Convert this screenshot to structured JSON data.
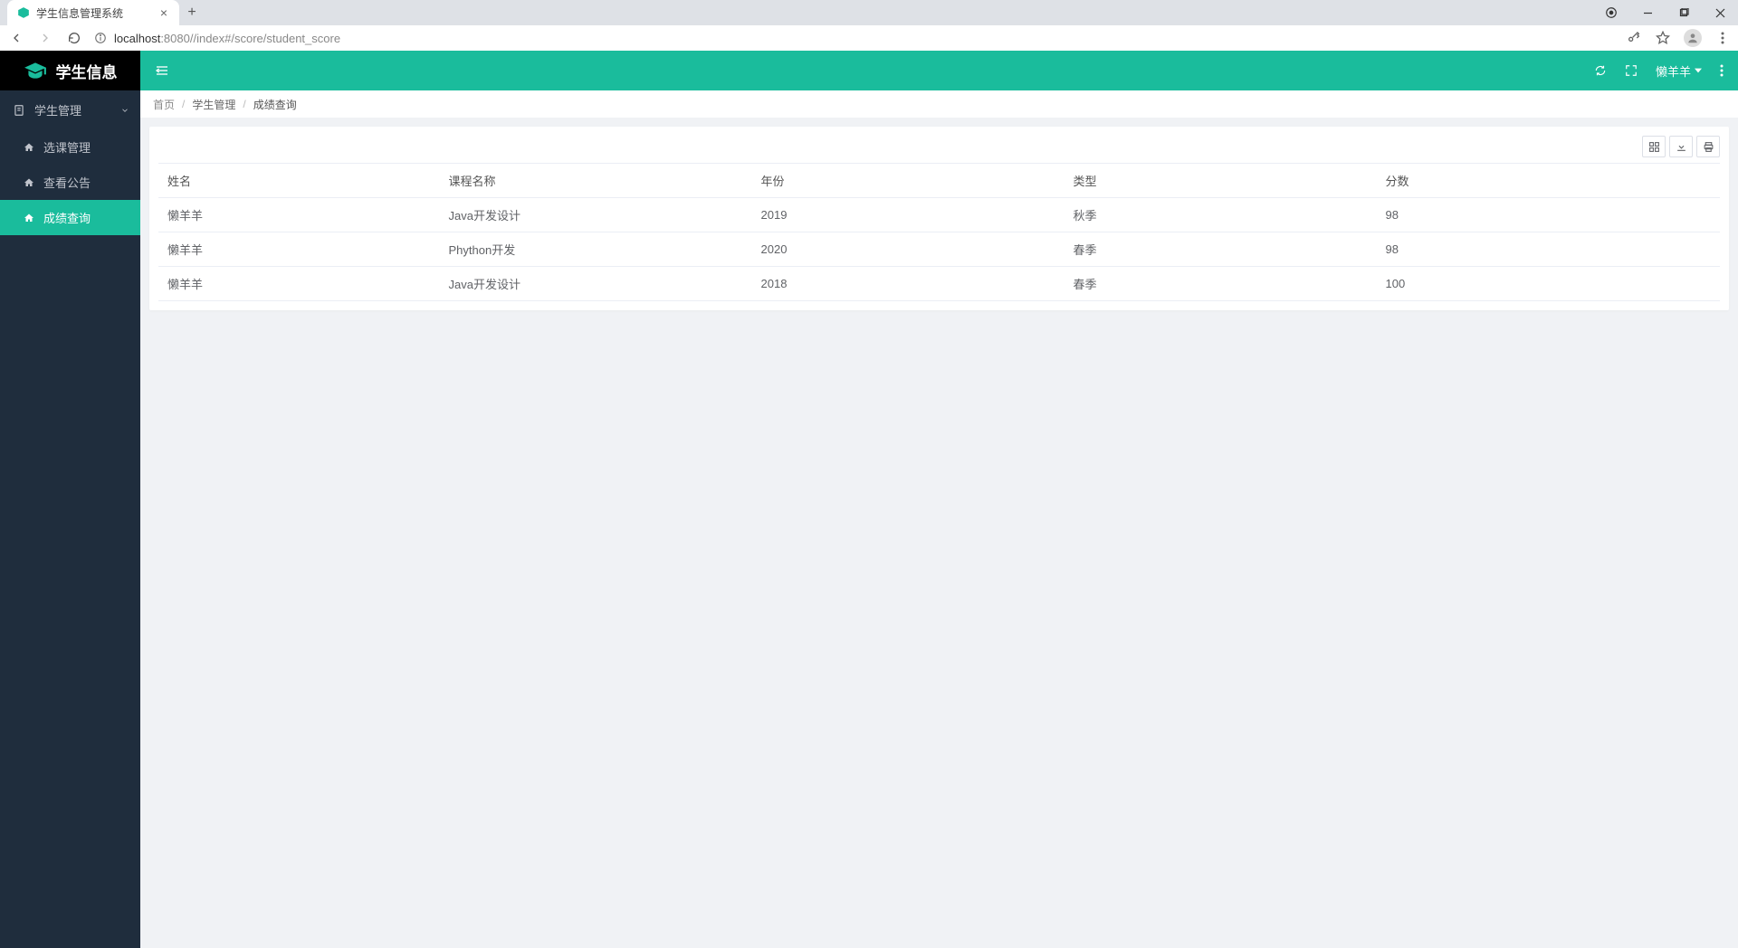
{
  "browser": {
    "tab_title": "学生信息管理系统",
    "url_host": "localhost",
    "url_port": ":8080",
    "url_path": "//index#/score/student_score"
  },
  "logo": {
    "text": "学生信息"
  },
  "sidebar": {
    "group_label": "学生管理",
    "items": [
      {
        "label": "选课管理"
      },
      {
        "label": "查看公告"
      },
      {
        "label": "成绩查询"
      }
    ]
  },
  "topbar": {
    "user": "懒羊羊"
  },
  "breadcrumb": {
    "items": [
      "首页",
      "学生管理",
      "成绩查询"
    ]
  },
  "table": {
    "headers": [
      "姓名",
      "课程名称",
      "年份",
      "类型",
      "分数"
    ],
    "rows": [
      {
        "name": "懒羊羊",
        "course": "Java开发设计",
        "year": "2019",
        "term": "秋季",
        "score": "98"
      },
      {
        "name": "懒羊羊",
        "course": "Phython开发",
        "year": "2020",
        "term": "春季",
        "score": "98"
      },
      {
        "name": "懒羊羊",
        "course": "Java开发设计",
        "year": "2018",
        "term": "春季",
        "score": "100"
      }
    ]
  }
}
